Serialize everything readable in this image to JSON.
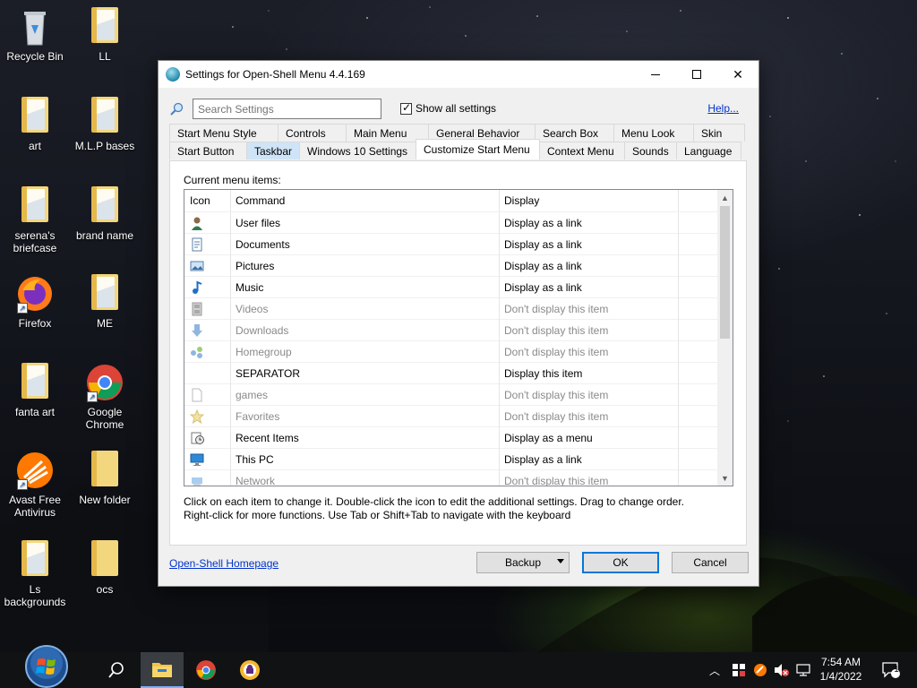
{
  "desktop": {
    "icons": [
      {
        "label": "Recycle Bin"
      },
      {
        "label": "LL"
      },
      {
        "label": "art"
      },
      {
        "label": "M.L.P bases"
      },
      {
        "label": "serena's briefcase"
      },
      {
        "label": "brand name"
      },
      {
        "label": "Firefox"
      },
      {
        "label": "ME"
      },
      {
        "label": "fanta art"
      },
      {
        "label": "Google Chrome"
      },
      {
        "label": "Avast Free Antivirus"
      },
      {
        "label": "New folder"
      },
      {
        "label": "Ls backgrounds"
      },
      {
        "label": "ocs"
      }
    ]
  },
  "window": {
    "title": "Settings for Open-Shell Menu 4.4.169",
    "search_placeholder": "Search Settings",
    "show_all_label": "Show all settings",
    "show_all_checked": true,
    "help_link": "Help...",
    "tabs_row1": [
      "Start Menu Style",
      "Controls",
      "Main Menu",
      "General Behavior",
      "Search Box",
      "Menu Look",
      "Skin"
    ],
    "tabs_row2": [
      "Start Button",
      "Taskbar",
      "Windows 10 Settings",
      "Customize Start Menu",
      "Context Menu",
      "Sounds",
      "Language"
    ],
    "active_tab": "Customize Start Menu",
    "highlighted_tab": "Taskbar",
    "panel_label": "Current menu items:",
    "columns": {
      "icon": "Icon",
      "command": "Command",
      "display": "Display"
    },
    "rows": [
      {
        "icon": "user-icon",
        "command": "User files",
        "display": "Display as a link",
        "dim": false
      },
      {
        "icon": "document-icon",
        "command": "Documents",
        "display": "Display as a link",
        "dim": false
      },
      {
        "icon": "picture-icon",
        "command": "Pictures",
        "display": "Display as a link",
        "dim": false
      },
      {
        "icon": "music-note-icon",
        "command": "Music",
        "display": "Display as a link",
        "dim": false
      },
      {
        "icon": "film-icon",
        "command": "Videos",
        "display": "Don't display this item",
        "dim": true
      },
      {
        "icon": "download-arrow-icon",
        "command": "Downloads",
        "display": "Don't display this item",
        "dim": true
      },
      {
        "icon": "homegroup-icon",
        "command": "Homegroup",
        "display": "Don't display this item",
        "dim": true
      },
      {
        "icon": "",
        "command": "SEPARATOR",
        "display": "Display this item",
        "dim": false
      },
      {
        "icon": "blank-page-icon",
        "command": "games",
        "display": "Don't display this item",
        "dim": true
      },
      {
        "icon": "star-icon",
        "command": "Favorites",
        "display": "Don't display this item",
        "dim": true
      },
      {
        "icon": "recent-items-icon",
        "command": "Recent Items",
        "display": "Display as a menu",
        "dim": false
      },
      {
        "icon": "monitor-icon",
        "command": "This PC",
        "display": "Display as a link",
        "dim": false
      },
      {
        "icon": "network-icon",
        "command": "Network",
        "display": "Don't display this item",
        "dim": true
      }
    ],
    "hint_line1": "Click on each item to change it. Double-click the icon to edit the additional settings. Drag to change order.",
    "hint_line2": "Right-click for more functions. Use Tab or Shift+Tab to navigate with the keyboard",
    "homepage_link": "Open-Shell Homepage",
    "backup_label": "Backup",
    "ok_label": "OK",
    "cancel_label": "Cancel"
  },
  "taskbar": {
    "time": "7:54 AM",
    "date": "1/4/2022",
    "notification_count": "1"
  }
}
